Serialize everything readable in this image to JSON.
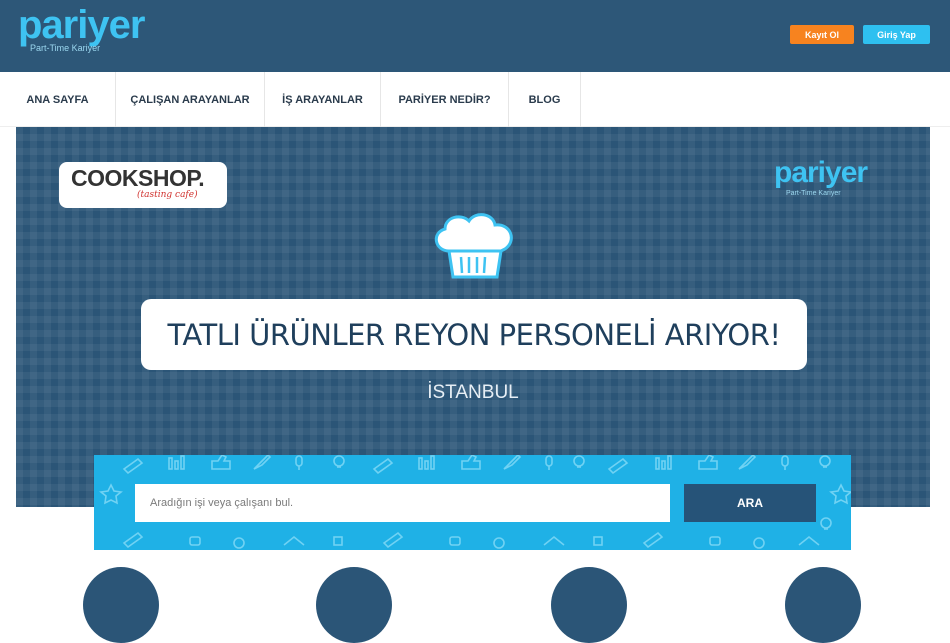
{
  "header": {
    "logo_text": "pariyer",
    "logo_subtitle": "Part-Time Kariyer",
    "register_label": "Kayıt Ol",
    "login_label": "Giriş Yap"
  },
  "nav": {
    "items": [
      {
        "label": "ANA SAYFA"
      },
      {
        "label": "ÇALIŞAN ARAYANLAR"
      },
      {
        "label": "İŞ ARAYANLAR"
      },
      {
        "label": "PARİYER NEDİR?"
      },
      {
        "label": "BLOG"
      }
    ]
  },
  "hero": {
    "brand_name": "COOKSHOP.",
    "brand_tagline": "(tasting cafe)",
    "logo_text": "pariyer",
    "logo_subtitle": "Part-Time Kariyer",
    "headline": "TATLI ÜRÜNLER REYON PERSONELİ ARIYOR!",
    "city": "İSTANBUL",
    "icon": "chef-hat-icon"
  },
  "search": {
    "placeholder": "Aradığın işi veya çalışanı bul.",
    "value": "",
    "button_label": "ARA"
  },
  "colors": {
    "header_bg": "#2d5778",
    "brand_blue": "#3ec3f2",
    "register_orange": "#f7831f",
    "login_blue": "#2ec0f0",
    "search_band": "#1fb1e6",
    "search_button": "#265378"
  }
}
